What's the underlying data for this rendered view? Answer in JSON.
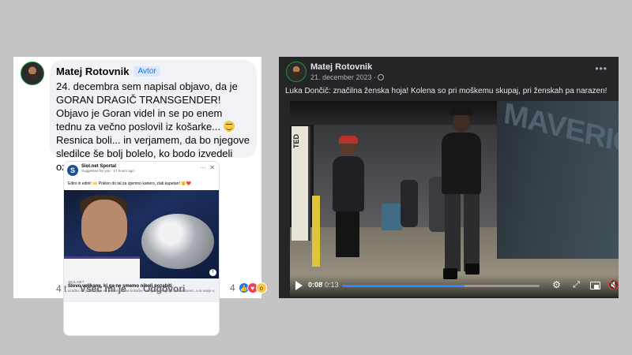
{
  "comment": {
    "author": "Matej Rotovnik",
    "badge": "Avtor",
    "text": "24. decembra sem napisal objavo, da je GORAN DRAGIČ TRANSGENDER! Objavo je Goran videl in se po enem tednu za večno poslovil iz košarke...",
    "text_part2": " Resnica boli... in verjamem, da bo njegove sledilce še bolj bolelo, ko bodo izvedeli ozadje...",
    "shared_post": {
      "page_name": "Siol.net Sportal",
      "meta": "Suggested for you · 17 hours ago ·",
      "text": "Edini in edini! 🙌 Poklon do tal za izjemno kariero, zlati kapetan! 🫡❤️",
      "domain": "SIOL.NET",
      "title": "Slovo velikana, ki ga ne smemo nikoli pozabiti",
      "description": "Uradno se poslavljam od profesionalne košarke. Vsega dobrega je enkrat konec, a te sanje o..."
    },
    "time": "4 t",
    "like_label": "Všeč mi je",
    "reply_label": "Odgovori",
    "reaction_count": "4"
  },
  "video_post": {
    "author": "Matej Rotovnik",
    "date": "21. december 2023 ·",
    "caption": "Luka Dončič: značilna ženska hoja! Kolena so pri moškemu skupaj, pri ženskah pa narazen!",
    "time_current": "0:08",
    "time_total": "/ 0:13",
    "progress": 0.62,
    "wall_text": "MAVERICK",
    "sign_text": "TED"
  },
  "icons": {
    "more": "more-options-icon",
    "globe": "globe-icon",
    "play": "play-icon",
    "settings": "gear-icon",
    "expand": "expand-icon",
    "pip": "picture-in-picture-icon",
    "mute": "mute-icon"
  },
  "colors": {
    "fb_blue": "#1877f2",
    "progress": "#2d88ff",
    "panel_dark": "#242526"
  }
}
